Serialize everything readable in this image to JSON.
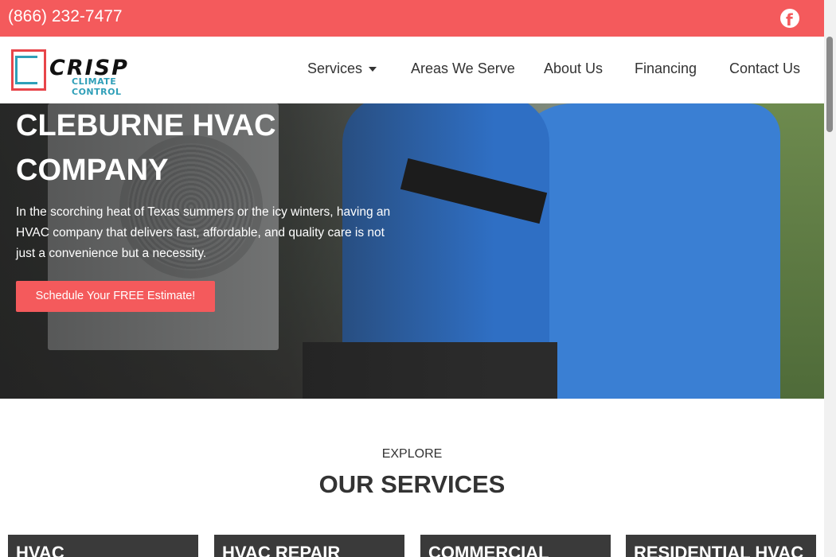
{
  "topbar": {
    "phone": "(866) 232-7477",
    "social_icon": "facebook-icon",
    "color": "#f45a5c"
  },
  "header": {
    "logo": {
      "word": "CRISP",
      "sub": "CLIMATE CONTROL"
    },
    "nav": [
      {
        "label": "Services",
        "has_dropdown": true
      },
      {
        "label": "Areas We Serve"
      },
      {
        "label": "About Us"
      },
      {
        "label": "Financing"
      },
      {
        "label": "Contact Us"
      }
    ]
  },
  "hero": {
    "title": "CLEBURNE HVAC COMPANY",
    "text": "In the scorching heat of Texas summers or the icy winters, having an HVAC company that delivers fast, affordable, and quality care is not just a convenience but a necessity.",
    "cta": "Schedule Your FREE Estimate!"
  },
  "services": {
    "eyebrow": "EXPLORE",
    "title": "OUR SERVICES",
    "cards": [
      "HVAC",
      "HVAC REPAIR",
      "COMMERCIAL",
      "RESIDENTIAL HVAC"
    ]
  }
}
